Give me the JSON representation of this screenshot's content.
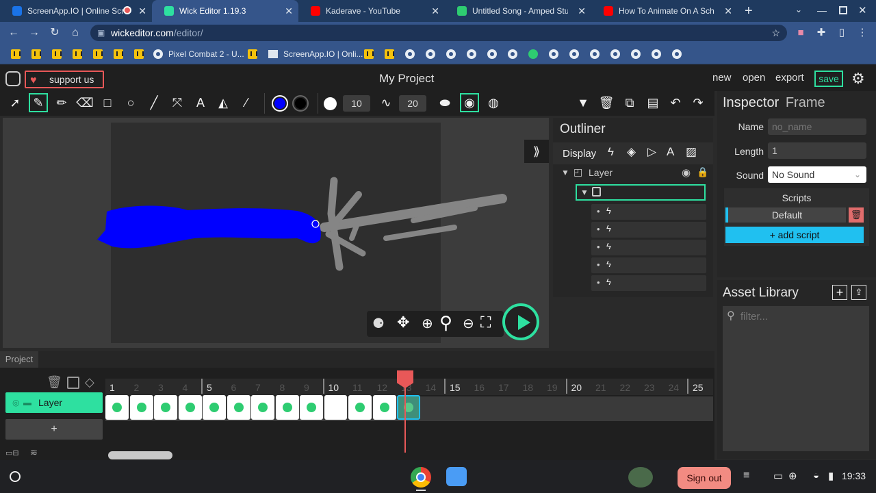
{
  "browser": {
    "tabs": [
      {
        "title": "ScreenApp.IO | Online Scre",
        "color": "#1a73e8"
      },
      {
        "title": "Wick Editor 1.19.3",
        "color": "#2ee0a0",
        "active": true
      },
      {
        "title": "Kaderave - YouTube",
        "color": "#ff0000"
      },
      {
        "title": "Untitled Song - Amped Studio",
        "color": "#2ecc71"
      },
      {
        "title": "How To Animate On A School",
        "color": "#ff0000"
      }
    ],
    "url_host": "wickeditor.com",
    "url_path": "/editor/",
    "bookmarks": [
      {
        "label": "Pixel Combat 2 - U..."
      },
      {
        "label": "ScreenApp.IO | Onli..."
      }
    ]
  },
  "editor": {
    "support_label": "support us",
    "project_title": "My Project",
    "menu": {
      "new": "new",
      "open": "open",
      "export": "export",
      "save": "save"
    },
    "brush_size": "10",
    "smoothing": "20",
    "colors": {
      "fill": "#0000ff",
      "stroke": "#000000"
    }
  },
  "outliner": {
    "title": "Outliner",
    "display_label": "Display",
    "layer_name": "Layer"
  },
  "inspector": {
    "title": "Inspector",
    "subtitle": "Frame",
    "name_label": "Name",
    "name_placeholder": "no_name",
    "length_label": "Length",
    "length_value": "1",
    "sound_label": "Sound",
    "sound_value": "No Sound",
    "scripts_label": "Scripts",
    "default_script": "Default",
    "add_script": "+ add script"
  },
  "assets": {
    "title": "Asset Library",
    "filter_placeholder": "filter..."
  },
  "timeline": {
    "tab_label": "Project",
    "layer_name": "Layer",
    "add_layer": "+",
    "frame_numbers": [
      "1",
      "2",
      "3",
      "4",
      "5",
      "6",
      "7",
      "8",
      "9",
      "10",
      "11",
      "12",
      "13",
      "14",
      "15",
      "16",
      "17",
      "18",
      "19",
      "20",
      "21",
      "22",
      "23",
      "24",
      "25"
    ]
  },
  "taskbar": {
    "sign_out": "Sign out",
    "time": "19:33"
  }
}
